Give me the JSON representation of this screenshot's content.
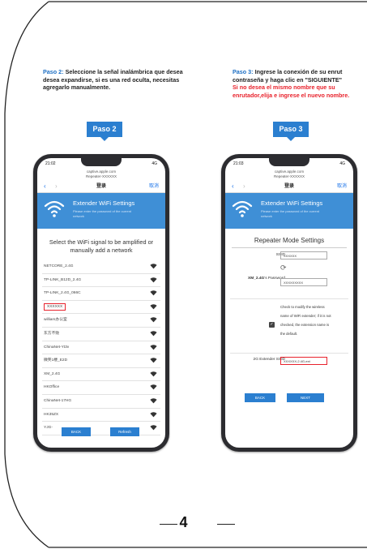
{
  "step2": {
    "title": "Paso 2:",
    "body": "Seleccione la señal inalámbrica que desea desea expandirse, si es una red oculta, necesitas agregarlo manualmente.",
    "badge": "Paso 2"
  },
  "step3": {
    "title": "Paso 3:",
    "body": "Ingrese la conexión de su enrut contraseña y haga clic en \"SIGUIENTE\"",
    "red": "Si no desea el mismo nombre que su enrutador,elija e ingrese el nuevo nombre.",
    "badge": "Paso 3"
  },
  "phone1": {
    "time": "21:02",
    "signal": "4G",
    "url_line1": "captive.apple.com",
    "url_line2": "Repeater-XXXXXX",
    "nav_title": "登录",
    "nav_cancel": "取消",
    "banner_title": "Extender WiFi Settings",
    "banner_sub": "Please enter the password of the current network",
    "select_heading": "Select the WiFi signal to be amplified or manually add a network",
    "networks": [
      {
        "name": "NETCORE_2.4G"
      },
      {
        "name": "TP-LINK_B12D_2.4G"
      },
      {
        "name": "TP-LINK_2.4G_066C"
      },
      {
        "name": "XXXXXX"
      },
      {
        "name": "william办公室"
      },
      {
        "name": "东方不败"
      },
      {
        "name": "ChinaNet-Yt3v"
      },
      {
        "name": "微笑1楼_E2D"
      },
      {
        "name": "XM_2.4G"
      },
      {
        "name": "HKOffice"
      },
      {
        "name": "ChinaNet-17HG"
      },
      {
        "name": "HK35ZX"
      },
      {
        "name": "YJG-"
      }
    ],
    "back": "BACK",
    "refresh": "Refresh"
  },
  "phone2": {
    "time": "21:03",
    "signal": "4G",
    "url_line1": "captive.apple.com",
    "url_line2": "Repeater-XXXXXX",
    "nav_title": "登录",
    "nav_cancel": "取消",
    "banner_title": "Extender WiFi Settings",
    "banner_sub": "Please enter the password of the current network",
    "mode_title": "Repeater Mode Settings",
    "ssid_label": "SSID",
    "ssid_value": "XXXXXX",
    "pass_label_bold": "XM_2.4G",
    "pass_label_rest": "'s Password",
    "pass_value": "XXXXXXXXX",
    "check_text": "Check to modify the wireless name of WiFi extender; if it is not checked, the extension name is the default.",
    "ext_label": "2G Extender SSID",
    "ext_value": "XXXXXX-2.4G-ext",
    "back": "BACK",
    "next": "NEXT"
  },
  "page_number": "4"
}
